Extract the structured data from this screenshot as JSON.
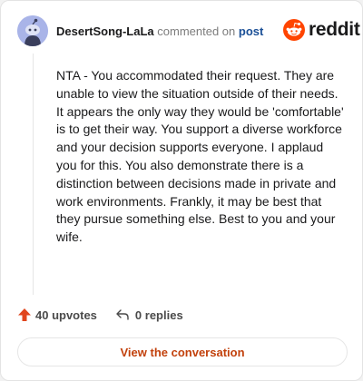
{
  "header": {
    "username": "DesertSong-LaLa",
    "action_text": "commented on",
    "post_link": "post"
  },
  "brand": {
    "wordmark": "reddit",
    "icon": "reddit-snoo-icon",
    "color": "#ff4500"
  },
  "comment": {
    "body": "NTA - You accommodated their request. They are unable to view the situation outside of their needs. It appears the only way they would be 'comfortable' is to get their way. You support a diverse workforce and your decision supports everyone. I applaud you for this. You also demonstrate there is a distinction between decisions made in private and work environments. Frankly, it may be best that they pursue something else. Best to you and your wife."
  },
  "footer": {
    "upvotes_label": "40 upvotes",
    "upvote_icon": "upvote-arrow-icon",
    "replies_label": "0 replies",
    "reply_icon": "reply-arrow-icon"
  },
  "cta": {
    "label": "View the conversation",
    "color": "#c2410c"
  },
  "colors": {
    "avatar_bg": "#a9b4e8",
    "upvote": "#e0461e",
    "link": "#1a4f96"
  }
}
